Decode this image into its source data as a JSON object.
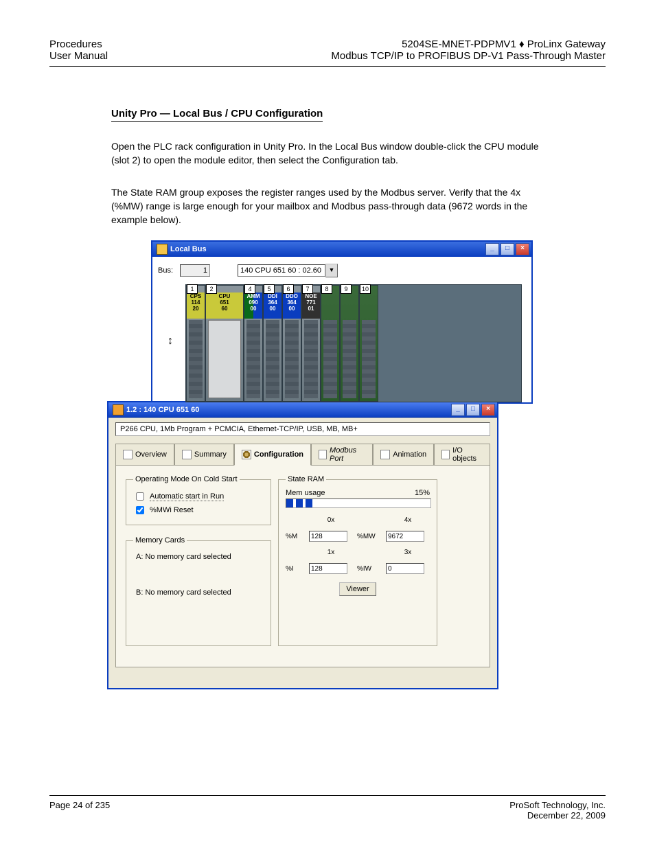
{
  "header": {
    "left_line1": "Procedures",
    "left_line2": "User Manual",
    "right_line1": "5204SE-MNET-PDPMV1 ♦ ProLinx Gateway",
    "right_line2": "Modbus TCP/IP to PROFIBUS DP-V1 Pass-Through Master"
  },
  "section": {
    "title": "Unity Pro — Local Bus / CPU Configuration",
    "para1": "Open the PLC rack configuration in Unity Pro. In the Local Bus window double-click the CPU module (slot 2) to open the module editor, then select the Configuration tab.",
    "para2": "The State RAM group exposes the register ranges used by the Modbus server. Verify that the 4x (%MW) range is large enough for your mailbox and Modbus pass-through data (9672 words in the example below)."
  },
  "localbus": {
    "title": "Local Bus",
    "bus_label": "Bus:",
    "bus_value": "1",
    "combo_value": "140 CPU 651 60 : 02.60",
    "slots": [
      {
        "n": "1",
        "name": "CPS",
        "l2": "114",
        "l3": "20",
        "cls": "cps"
      },
      {
        "n": "2",
        "name": "CPU",
        "l2": "651",
        "l3": "60",
        "cls": "cpu"
      },
      {
        "n": "4",
        "name": "AMM",
        "l2": "090",
        "l3": "00",
        "cls": "amm"
      },
      {
        "n": "5",
        "name": "DDI",
        "l2": "364",
        "l3": "00",
        "cls": "ddi"
      },
      {
        "n": "6",
        "name": "DDO",
        "l2": "364",
        "l3": "00",
        "cls": "ddo"
      },
      {
        "n": "7",
        "name": "NOE",
        "l2": "771",
        "l3": "01",
        "cls": "noe"
      },
      {
        "n": "8",
        "name": "",
        "l2": "",
        "l3": "",
        "cls": "empty"
      },
      {
        "n": "9",
        "name": "",
        "l2": "",
        "l3": "",
        "cls": "empty"
      },
      {
        "n": "10",
        "name": "",
        "l2": "",
        "l3": "",
        "cls": "empty"
      }
    ]
  },
  "cfgwin": {
    "title": "1.2 : 140 CPU 651 60",
    "desc": "P266 CPU, 1Mb Program + PCMCIA, Ethernet-TCP/IP, USB, MB, MB+",
    "tabs": {
      "overview": "Overview",
      "summary": "Summary",
      "configuration": "Configuration",
      "modbusport": "Modbus Port",
      "animation": "Animation",
      "ioobjects": "I/O objects"
    },
    "opmode": {
      "legend": "Operating Mode On Cold Start",
      "auto": "Automatic start in Run",
      "reset": "%MWi Reset"
    },
    "memcards": {
      "legend": "Memory Cards",
      "a": "A: No memory card selected",
      "b": "B: No memory card selected"
    },
    "sram": {
      "legend": "State RAM",
      "memusage": "Mem usage",
      "pct": "15%",
      "h0x": "0x",
      "h4x": "4x",
      "h1x": "1x",
      "h3x": "3x",
      "l_m": "%M",
      "l_mw": "%MW",
      "l_i": "%I",
      "l_iw": "%IW",
      "v0x": "128",
      "v4x": "9672",
      "v1x": "128",
      "v3x": "0",
      "viewer": "Viewer"
    }
  },
  "footer": {
    "left": "Page 24 of 235",
    "right": "ProSoft Technology, Inc.",
    "right2": "December 22, 2009"
  }
}
